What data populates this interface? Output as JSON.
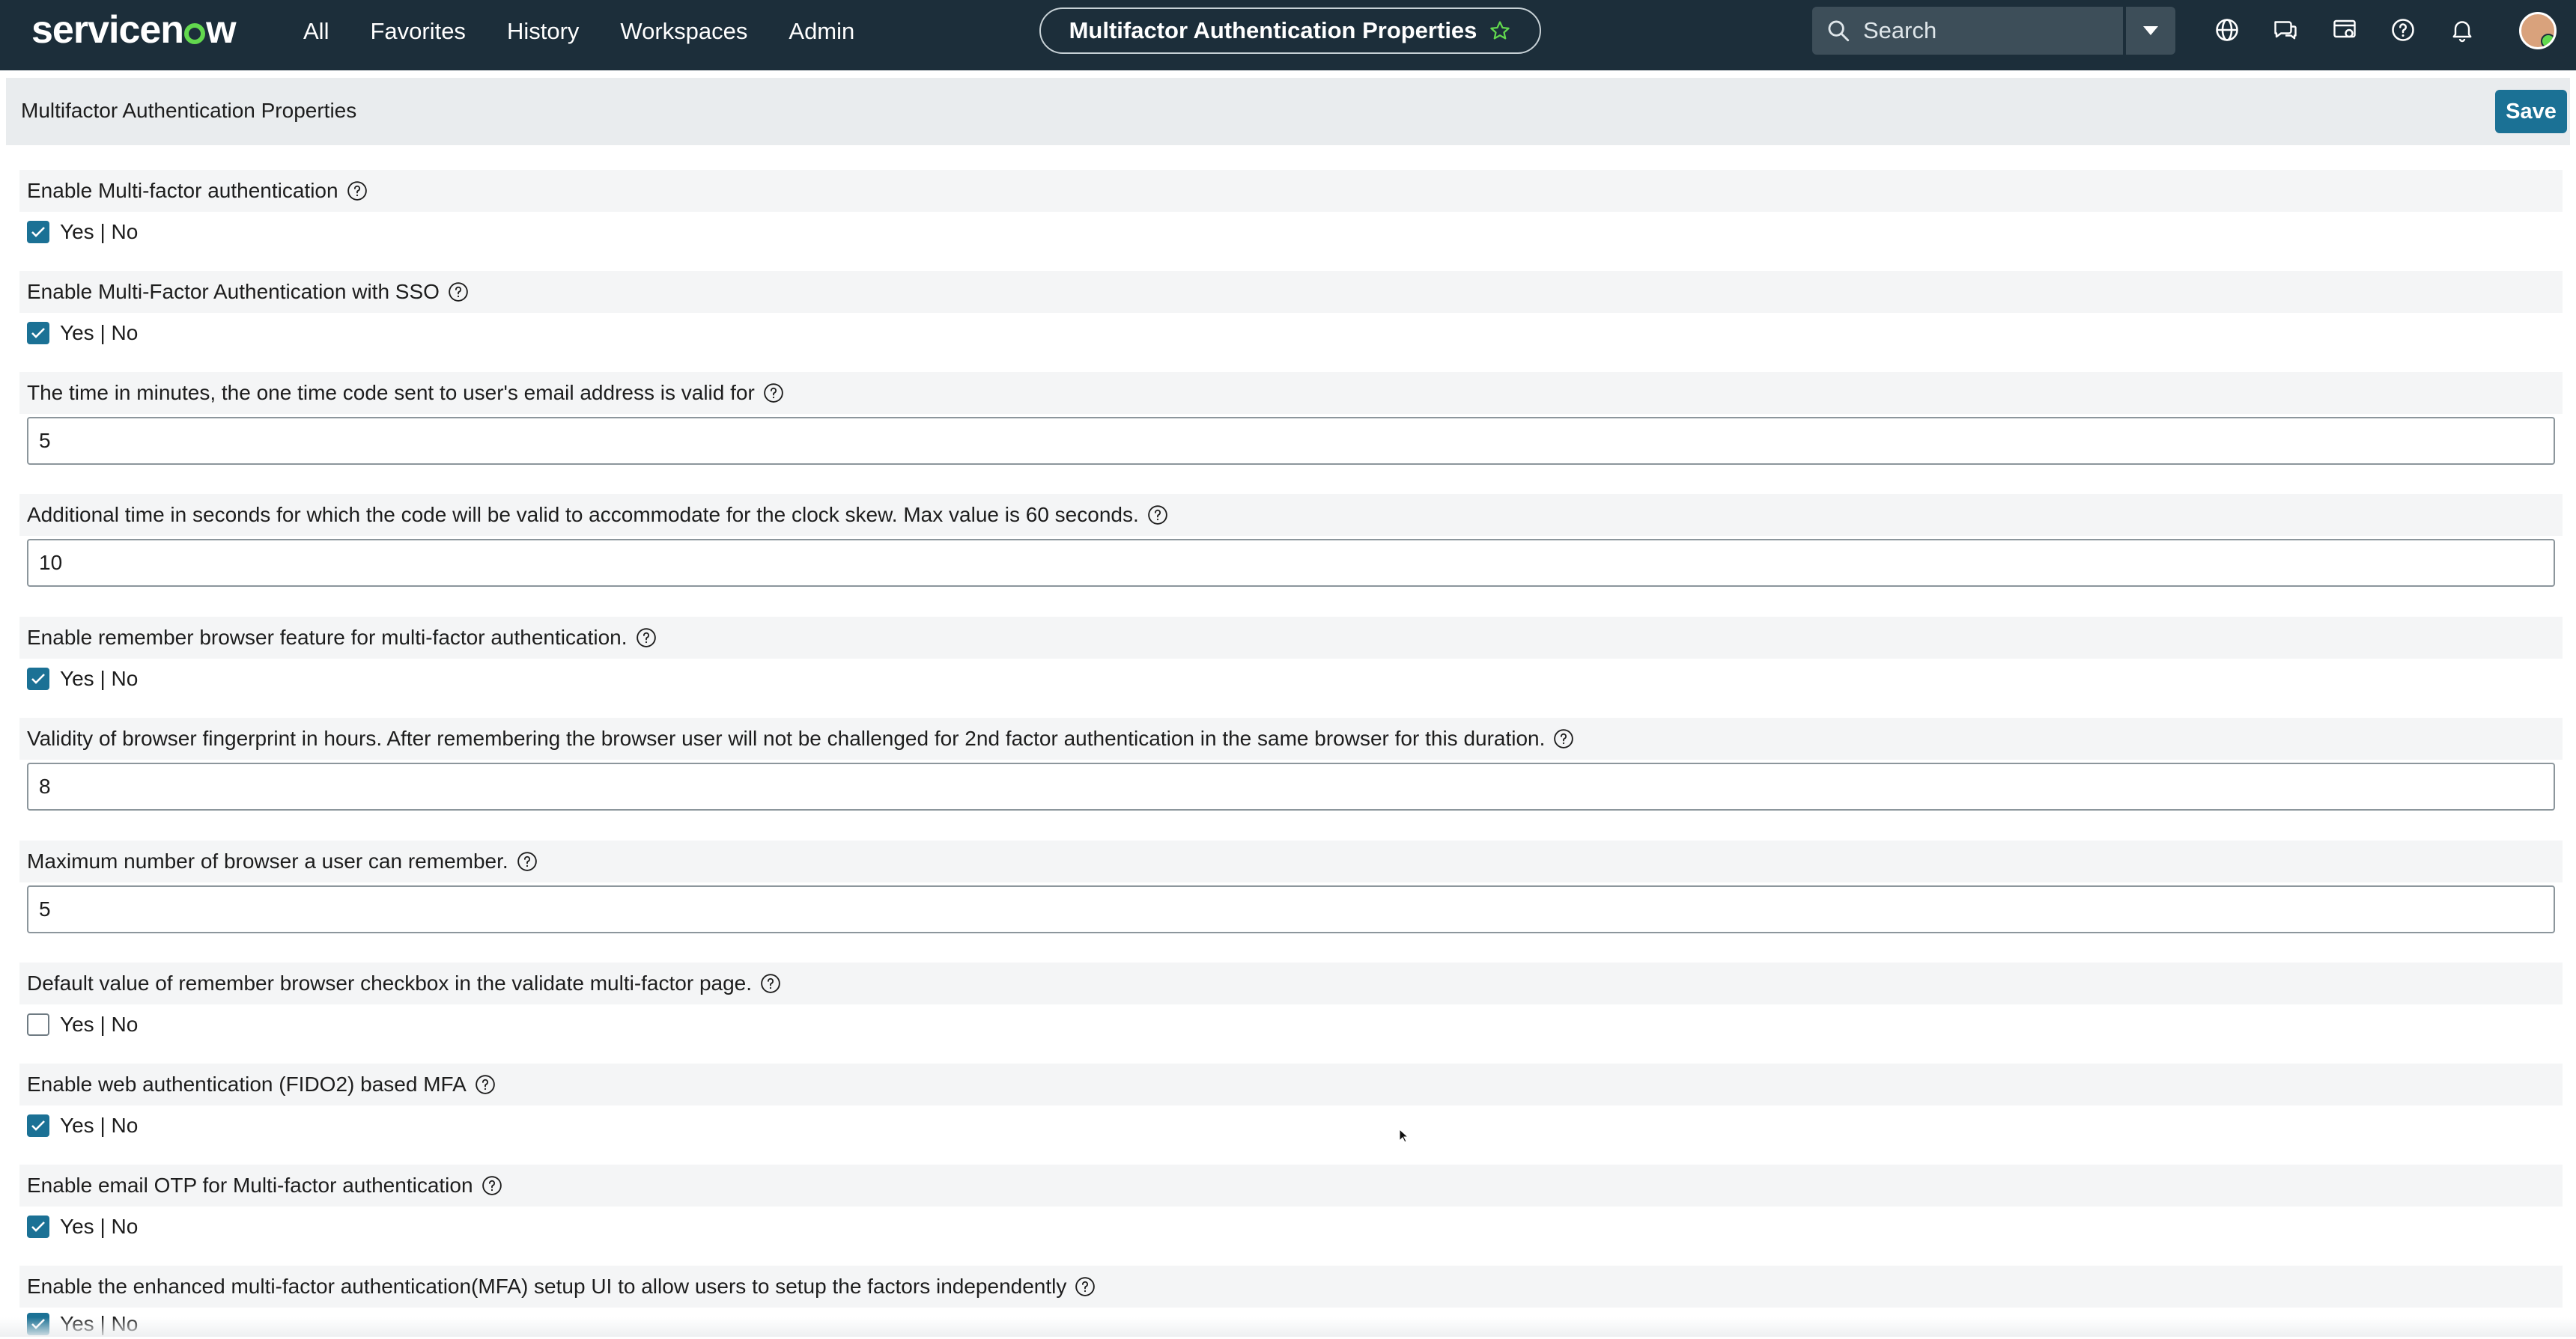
{
  "topnav": {
    "brand": "servicenow",
    "brand_accent": "#62d84e",
    "items": [
      "All",
      "Favorites",
      "History",
      "Workspaces",
      "Admin"
    ],
    "context_title": "Multifactor Authentication Properties",
    "search": {
      "placeholder": "Search"
    },
    "icons": [
      "globe-icon",
      "chat-icon",
      "contextual-app-icon",
      "help-icon",
      "bell-icon"
    ]
  },
  "header": {
    "title": "Multifactor Authentication Properties",
    "save_label": "Save"
  },
  "properties": [
    {
      "label": "Enable Multi-factor authentication",
      "type": "checkbox",
      "checked": true,
      "option_label": "Yes | No"
    },
    {
      "label": "Enable Multi-Factor Authentication with SSO",
      "type": "checkbox",
      "checked": true,
      "option_label": "Yes | No"
    },
    {
      "label": "The time in minutes, the one time code sent to user's email address is valid for",
      "type": "text",
      "value": "5"
    },
    {
      "label": "Additional time in seconds for which the code will be valid to accommodate for the clock skew. Max value is 60 seconds.",
      "type": "text",
      "value": "10"
    },
    {
      "label": "Enable remember browser feature for multi-factor authentication.",
      "type": "checkbox",
      "checked": true,
      "option_label": "Yes | No"
    },
    {
      "label": "Validity of browser fingerprint in hours. After remembering the browser user will not be challenged for 2nd factor authentication in the same browser for this duration.",
      "type": "text",
      "value": "8"
    },
    {
      "label": "Maximum number of browser a user can remember.",
      "type": "text",
      "value": "5"
    },
    {
      "label": "Default value of remember browser checkbox in the validate multi-factor page.",
      "type": "checkbox",
      "checked": false,
      "option_label": "Yes | No"
    },
    {
      "label": "Enable web authentication (FIDO2) based MFA",
      "type": "checkbox",
      "checked": true,
      "option_label": "Yes | No"
    },
    {
      "label": "Enable email OTP for Multi-factor authentication",
      "type": "checkbox",
      "checked": true,
      "option_label": "Yes | No"
    },
    {
      "label": "Enable the enhanced multi-factor authentication(MFA) setup UI to allow users to setup the factors independently",
      "type": "checkbox",
      "checked": true,
      "option_label": "Yes | No"
    }
  ],
  "colors": {
    "nav_bg": "#1c2e3a",
    "primary": "#1b7195",
    "label_row_bg": "#f4f5f6"
  }
}
